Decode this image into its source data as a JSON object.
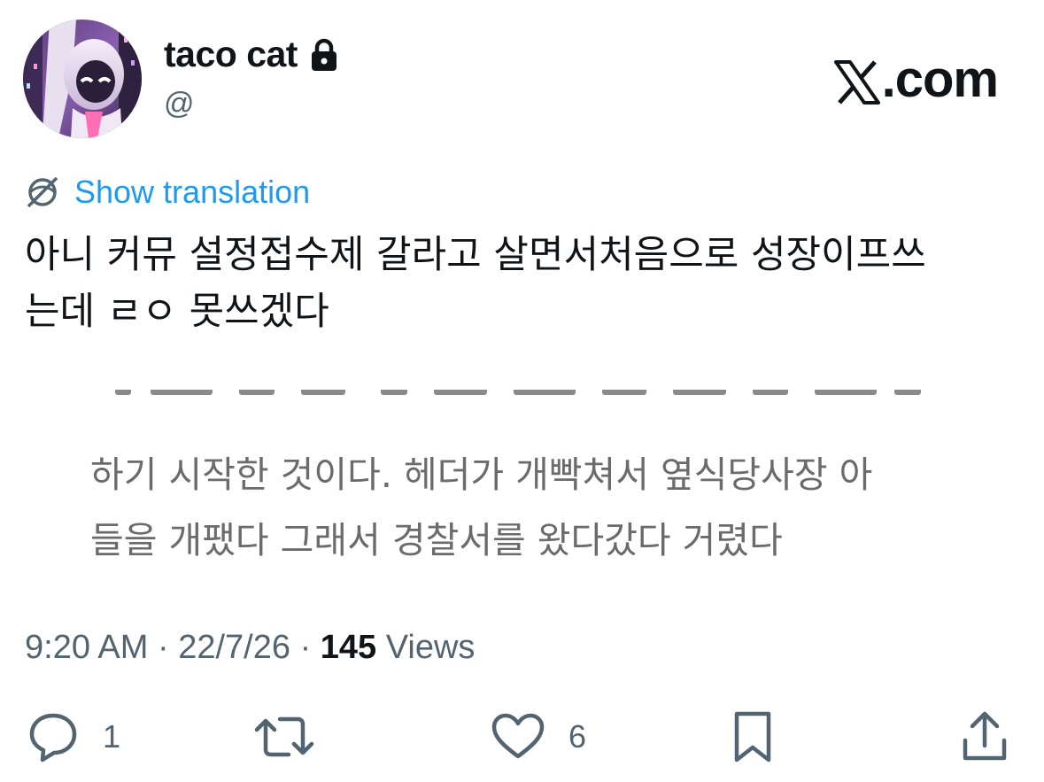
{
  "author": {
    "display_name": "taco cat",
    "handle": "@",
    "protected": true
  },
  "site_logo_text": ".com",
  "translate": {
    "label": "Show translation"
  },
  "tweet": {
    "lines": [
      "아니 커뮤 설정접수제 갈라고 살면서처음으로 성장이프쓰",
      "는데 ㄹㅇ 못쓰겠다"
    ]
  },
  "embedded_image": {
    "lines": [
      "하기 시작한 것이다. 헤더가 개빡쳐서 옆식당사장 아",
      "들을 개팼다 그래서 경찰서를 왔다갔다 거렸다"
    ]
  },
  "meta": {
    "time": "9:20 AM",
    "separator": "·",
    "date": "22/7/26",
    "views_count": "145",
    "views_label": "Views"
  },
  "actions": {
    "reply_count": "1",
    "like_count": "6"
  },
  "colors": {
    "link": "#1d9bf0",
    "secondary_text": "#536471",
    "primary_text": "#0f1419",
    "embedded_text": "#6b6b6b"
  },
  "icons": {
    "lock": "lock-icon",
    "translate": "translate-icon",
    "reply": "reply-icon",
    "retweet": "retweet-icon",
    "like": "heart-icon",
    "bookmark": "bookmark-icon",
    "share": "share-icon",
    "logo": "x-logo-icon"
  }
}
